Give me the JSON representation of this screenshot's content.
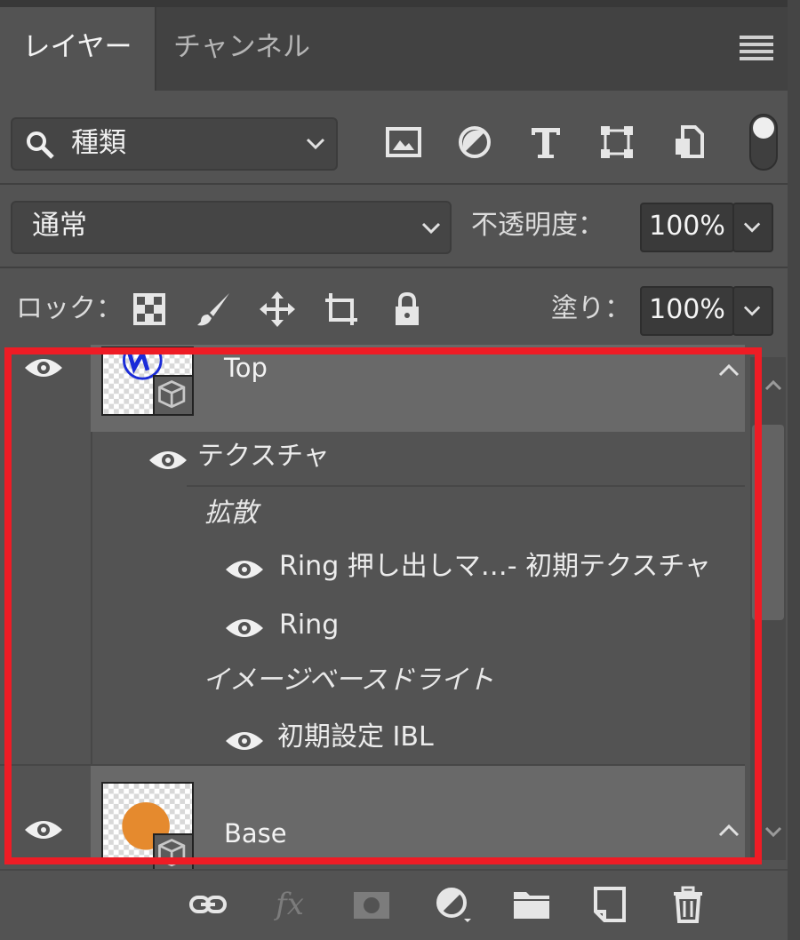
{
  "tabs": [
    {
      "label": "レイヤー",
      "active": true
    },
    {
      "label": "チャンネル",
      "active": false
    }
  ],
  "filter": {
    "label": "種類"
  },
  "blend": {
    "mode": "通常",
    "opacity_label": "不透明度：",
    "opacity_value": "100%"
  },
  "lock": {
    "label": "ロック：",
    "fill_label": "塗り：",
    "fill_value": "100%"
  },
  "layers": {
    "top": {
      "name": "Top"
    },
    "sub": {
      "texture": "テクスチャ",
      "diffuse": "拡散",
      "ring_texture": "Ring 押し出しマ…- 初期テクスチャ",
      "ring": "Ring",
      "ibl_group": "イメージベースドライト",
      "ibl": "初期設定 IBL"
    },
    "base": {
      "name": "Base"
    }
  },
  "colors": {
    "highlight": "#ee1c25",
    "panel": "#535353",
    "row_selected": "#696969",
    "thumb_orange": "#e58a2e",
    "thumb_blue": "#1a2bd8"
  }
}
